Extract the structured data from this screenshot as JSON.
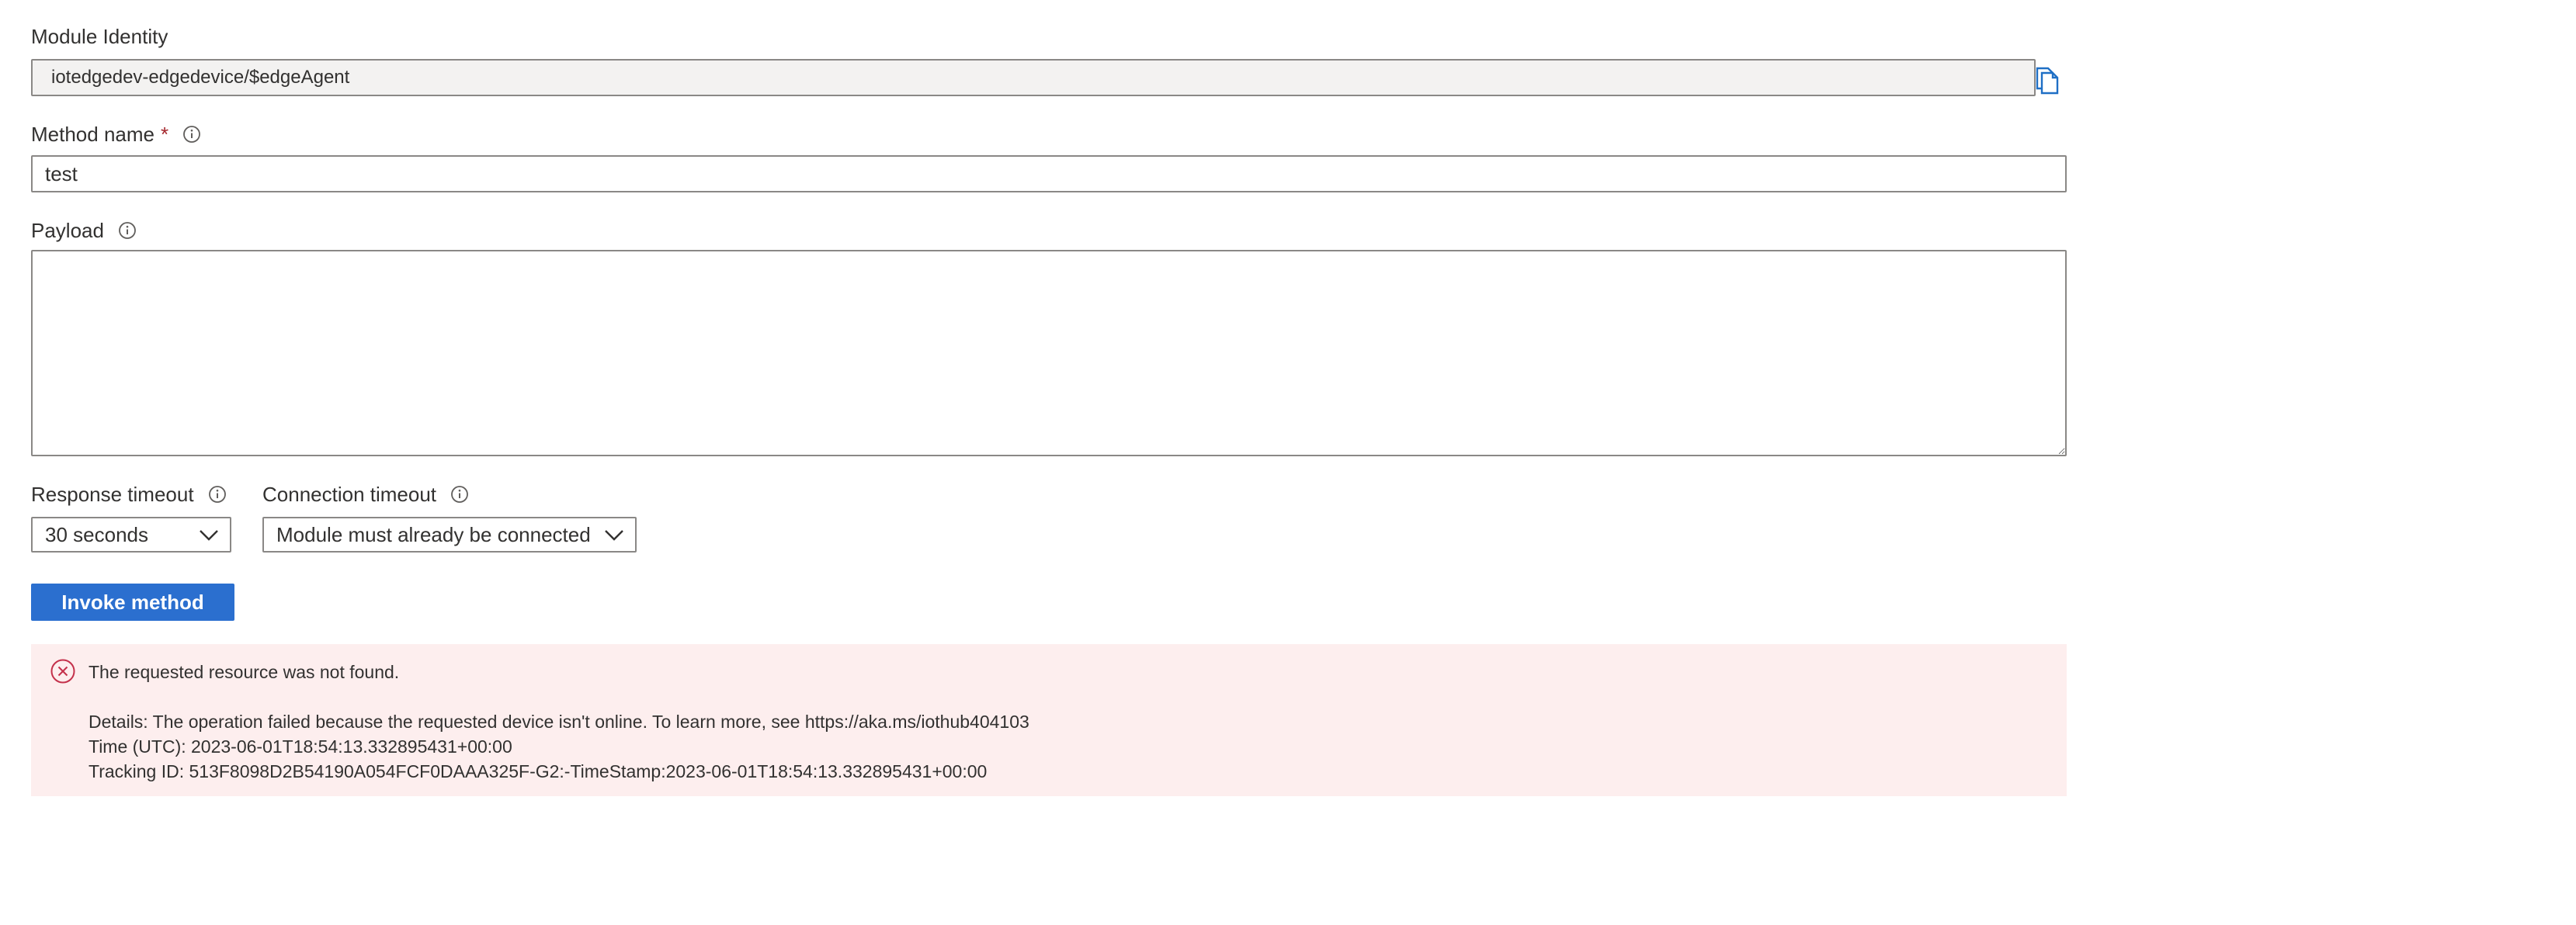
{
  "module_identity": {
    "label": "Module Identity",
    "value": "iotedgedev-edgedevice/$edgeAgent",
    "copy_icon": "copy-icon"
  },
  "method_name": {
    "label": "Method name",
    "required_mark": "*",
    "value": "test",
    "info_icon": "info-icon"
  },
  "payload": {
    "label": "Payload",
    "value": "",
    "info_icon": "info-icon"
  },
  "response_timeout": {
    "label": "Response timeout",
    "selected": "30 seconds",
    "info_icon": "info-icon"
  },
  "connection_timeout": {
    "label": "Connection timeout",
    "selected": "Module must already be connected",
    "info_icon": "info-icon"
  },
  "invoke_button": {
    "label": "Invoke method",
    "color": "#2b6fcf"
  },
  "error": {
    "icon": "error-circle-icon",
    "title": "The requested resource was not found.",
    "details_line": "Details: The operation failed because the requested device isn't online. To learn more, see https://aka.ms/iothub404103",
    "time_line": "Time (UTC): 2023-06-01T18:54:13.332895431+00:00",
    "tracking_line": "Tracking ID: 513F8098D2B54190A054FCF0DAAA325F-G2:-TimeStamp:2023-06-01T18:54:13.332895431+00:00",
    "background_color": "#fdeeee",
    "icon_color": "#c4314b"
  },
  "colors": {
    "accent": "#2b6fcf",
    "required": "#a4262c",
    "border": "#8a8886"
  }
}
